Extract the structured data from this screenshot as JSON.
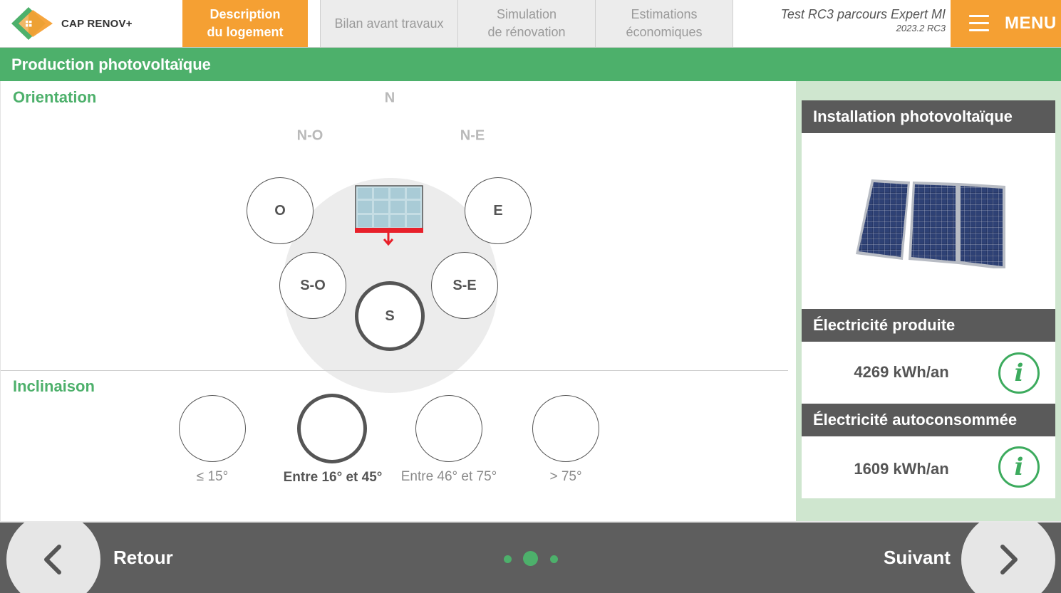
{
  "header": {
    "logo_text": "CAP RENOV+",
    "tabs": [
      {
        "label": "Description\ndu logement",
        "active": true
      },
      {
        "label": "Bilan avant travaux",
        "active": false
      },
      {
        "label": "Simulation\nde rénovation",
        "active": false
      },
      {
        "label": "Estimations\néconomiques",
        "active": false
      }
    ],
    "project_name": "Test RC3 parcours Expert MI",
    "project_version": "2023.2 RC3",
    "menu_label": "MENU"
  },
  "section_title": "Production photovoltaïque",
  "orientation": {
    "label": "Orientation",
    "background_labels": [
      "N",
      "N-O",
      "N-E"
    ],
    "options": [
      "O",
      "E",
      "S-O",
      "S-E",
      "S"
    ],
    "selected": "S"
  },
  "inclinaison": {
    "label": "Inclinaison",
    "options": [
      "≤ 15°",
      "Entre 16° et 45°",
      "Entre 46° et 75°",
      "> 75°"
    ],
    "selected": "Entre 16° et 45°"
  },
  "right_panel": {
    "installation_title": "Installation photovoltaïque",
    "produced_title": "Électricité produite",
    "produced_value": "4269 kWh/an",
    "self_consumed_title": "Électricité autoconsommée",
    "self_consumed_value": "1609 kWh/an",
    "info_glyph": "i"
  },
  "footer": {
    "back_label": "Retour",
    "next_label": "Suivant",
    "page_count": 3,
    "current_page": 2
  },
  "colors": {
    "orange": "#f5a033",
    "green": "#4db06b",
    "dark_gray": "#5a5a5a",
    "light_green": "#cfe6cf",
    "red": "#e8202a"
  }
}
